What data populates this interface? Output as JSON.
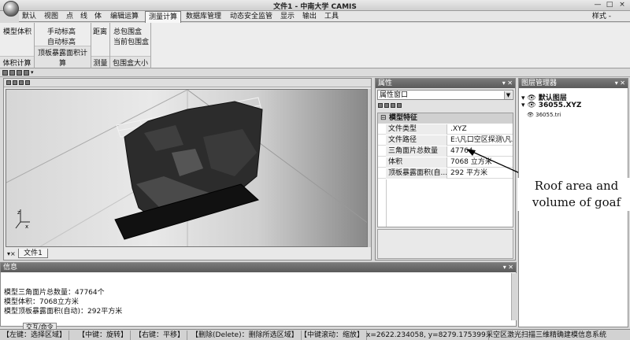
{
  "window": {
    "title": "文件1 - 中南大学 CAMIS",
    "minimize": "—",
    "maximize": "□",
    "close": "×",
    "style_menu": "样式 -"
  },
  "menu": {
    "items": [
      "默认",
      "视图",
      "点",
      "线",
      "体",
      "编辑运算",
      "测量计算",
      "数据库管理",
      "动态安全监管",
      "显示",
      "输出",
      "工具"
    ],
    "active": "测量计算"
  },
  "ribbon": {
    "groups": [
      {
        "label": "体积计算",
        "buttons": [
          "模型体积"
        ]
      },
      {
        "label": "顶板暴露面积计算",
        "buttons": [
          "手动标高",
          "自动标高"
        ]
      },
      {
        "label": "测量",
        "buttons": [
          "距离"
        ]
      },
      {
        "label": "包围盒大小",
        "buttons": [
          "总包围盒",
          "当前包围盒"
        ]
      }
    ]
  },
  "viewport": {
    "doc_tab": "文件1",
    "axis_label_x": "x",
    "axis_label_z": "z"
  },
  "properties": {
    "header": "属性",
    "selector_value": "属性窗口",
    "category": "模型特征",
    "rows": [
      {
        "key": "文件类型",
        "value": ".XYZ"
      },
      {
        "key": "文件路径",
        "value": "E:\\凡口空区探测\\凡..."
      },
      {
        "key": "三角面片总数量",
        "value": "47764"
      },
      {
        "key": "体积",
        "value": "7068 立方米"
      },
      {
        "key": "顶板暴露面积(自...",
        "value": "292 平方米"
      }
    ]
  },
  "layers": {
    "header": "图层管理器",
    "items": [
      "默认图层",
      "36055.XYZ",
      "36055.tri"
    ]
  },
  "info": {
    "header": "信息",
    "lines": [
      "模型三角面片总数量：47764个",
      "模型体积：7068立方米",
      "模型顶板暴露面积(自动)：292平方米"
    ],
    "tab": "交互/命令"
  },
  "status": {
    "items": [
      "【左键：选择区域】",
      "【中键：旋转】",
      "【右键：平移】",
      "【删除(Delete)：删除所选区域】",
      "【中键滚动：缩放】",
      "x=2622.234058, y=8279.175399",
      "采空区激光扫描三维精确建模信息系统"
    ]
  },
  "annotation": {
    "line1": "Roof area and",
    "line2": "volume of goaf"
  }
}
